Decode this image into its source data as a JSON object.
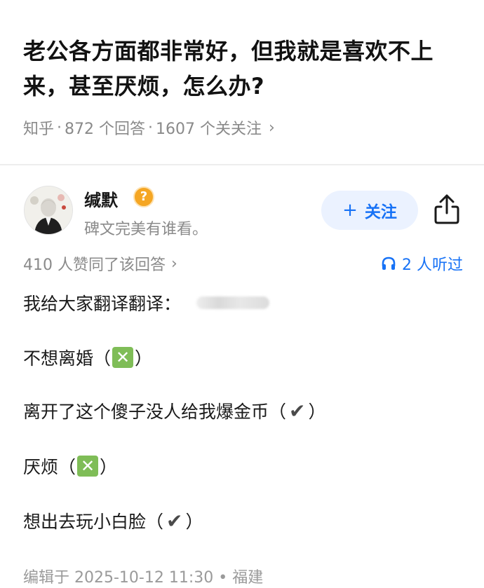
{
  "question": {
    "title": "老公各方面都非常好，但我就是喜欢不上来，甚至厌烦，怎么办?",
    "source": "知乎",
    "answers_count": "872 个回答",
    "followers_count": "1607 个关关注",
    "separator": "·",
    "chevron": "›"
  },
  "author": {
    "name": "缄默",
    "help_icon_glyph": "?",
    "bio": "碑文完美有谁看。",
    "follow_plus": "+",
    "follow_label": "关注"
  },
  "stats": {
    "agree_text": "410 人赞同了该回答",
    "chevron": "›",
    "listened_text": "2 人听过"
  },
  "content": {
    "line1": "我给大家翻译翻译：",
    "line2_text": "不想离婚",
    "line3_text": "离开了这个傻子没人给我爆金币",
    "line4_text": "厌烦",
    "line5_text": "想出去玩小白脸",
    "paren_open": "（",
    "paren_close": "）",
    "x_glyph": "✕",
    "check_glyph": "✔"
  },
  "footer": {
    "edited_text": "编辑于 2025-10-12 11:30 • 福建"
  },
  "colors": {
    "accent_blue": "#1772f6",
    "follow_bg": "#ebf2ff",
    "x_green": "#7fbd57",
    "help_orange": "#f5a623"
  }
}
